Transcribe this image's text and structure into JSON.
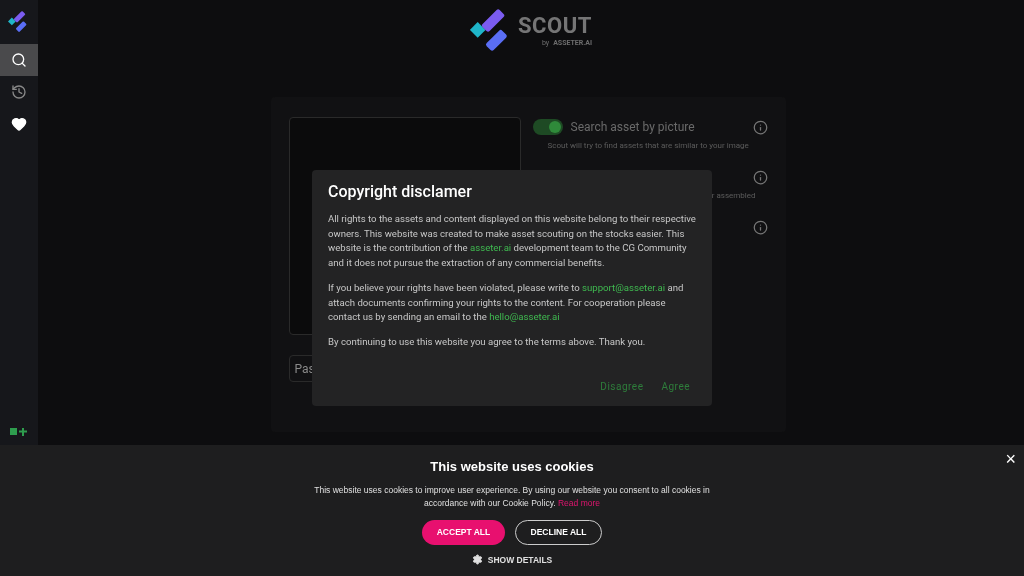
{
  "sidebar": {
    "items": [
      {
        "kind": "search",
        "selected": true
      },
      {
        "kind": "history",
        "selected": false
      },
      {
        "kind": "favorites",
        "selected": false
      }
    ]
  },
  "logo": {
    "name": "SCOUT",
    "by": "by",
    "brand": "ASSETER.AI"
  },
  "search_panel": {
    "options": [
      {
        "kind": "toggle",
        "label": "Search asset by picture",
        "description": "Scout will try to find assets that are similar to your image",
        "on": true
      },
      {
        "kind": "text",
        "description": "r assembled"
      },
      {
        "kind": "info"
      }
    ],
    "input": {
      "placeholder": "Pas"
    }
  },
  "modal": {
    "title": "Copyright disclamer",
    "paragraphs": [
      [
        {
          "text": "All rights to the assets and content displayed on this website belong to their respective owners. This website was created to make asset scouting on the stocks easier. This website is the contribution of the "
        },
        {
          "text": "asseter.ai",
          "link": true
        },
        {
          "text": " development team to the CG Community and it does not pursue the extraction of any commercial benefits."
        }
      ],
      [
        {
          "text": "If you believe your rights have been violated, please write to "
        },
        {
          "text": "support@asseter.ai",
          "link": true
        },
        {
          "text": " and attach documents confirming your rights to the content. For cooperation please contact us by sending an email to the "
        },
        {
          "text": "hello@asseter.ai",
          "link": true
        }
      ],
      [
        {
          "text": "By continuing to use this website you agree to the terms above. Thank you."
        }
      ]
    ],
    "buttons": [
      "Disagree",
      "Agree"
    ]
  },
  "cookies": {
    "title": "This website uses cookies",
    "text": "This website uses cookies to improve user experience. By using our website you consent to all cookies in accordance with our Cookie Policy.",
    "link": "Read more",
    "accept": "ACCEPT ALL",
    "decline": "DECLINE ALL",
    "details": "SHOW DETAILS",
    "close": "×"
  }
}
